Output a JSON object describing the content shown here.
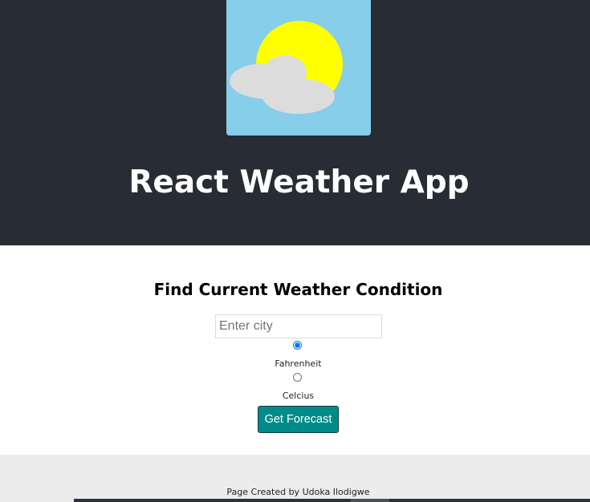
{
  "header": {
    "title": "React Weather App",
    "logo_icon": "sun-cloud-icon",
    "colors": {
      "background": "#282c34",
      "logo_background": "#87ceeb",
      "sun": "#ffff00",
      "cloud": "#dcdcdc"
    }
  },
  "form": {
    "heading": "Find Current Weather Condition",
    "city_placeholder": "Enter city",
    "city_value": "",
    "units": [
      {
        "label": "Fahrenheit",
        "checked": true
      },
      {
        "label": "Celcius",
        "checked": false
      }
    ],
    "submit_label": "Get Forecast",
    "button_color": "#008b8b"
  },
  "footer": {
    "text": "Page Created by Udoka Ilodigwe"
  }
}
